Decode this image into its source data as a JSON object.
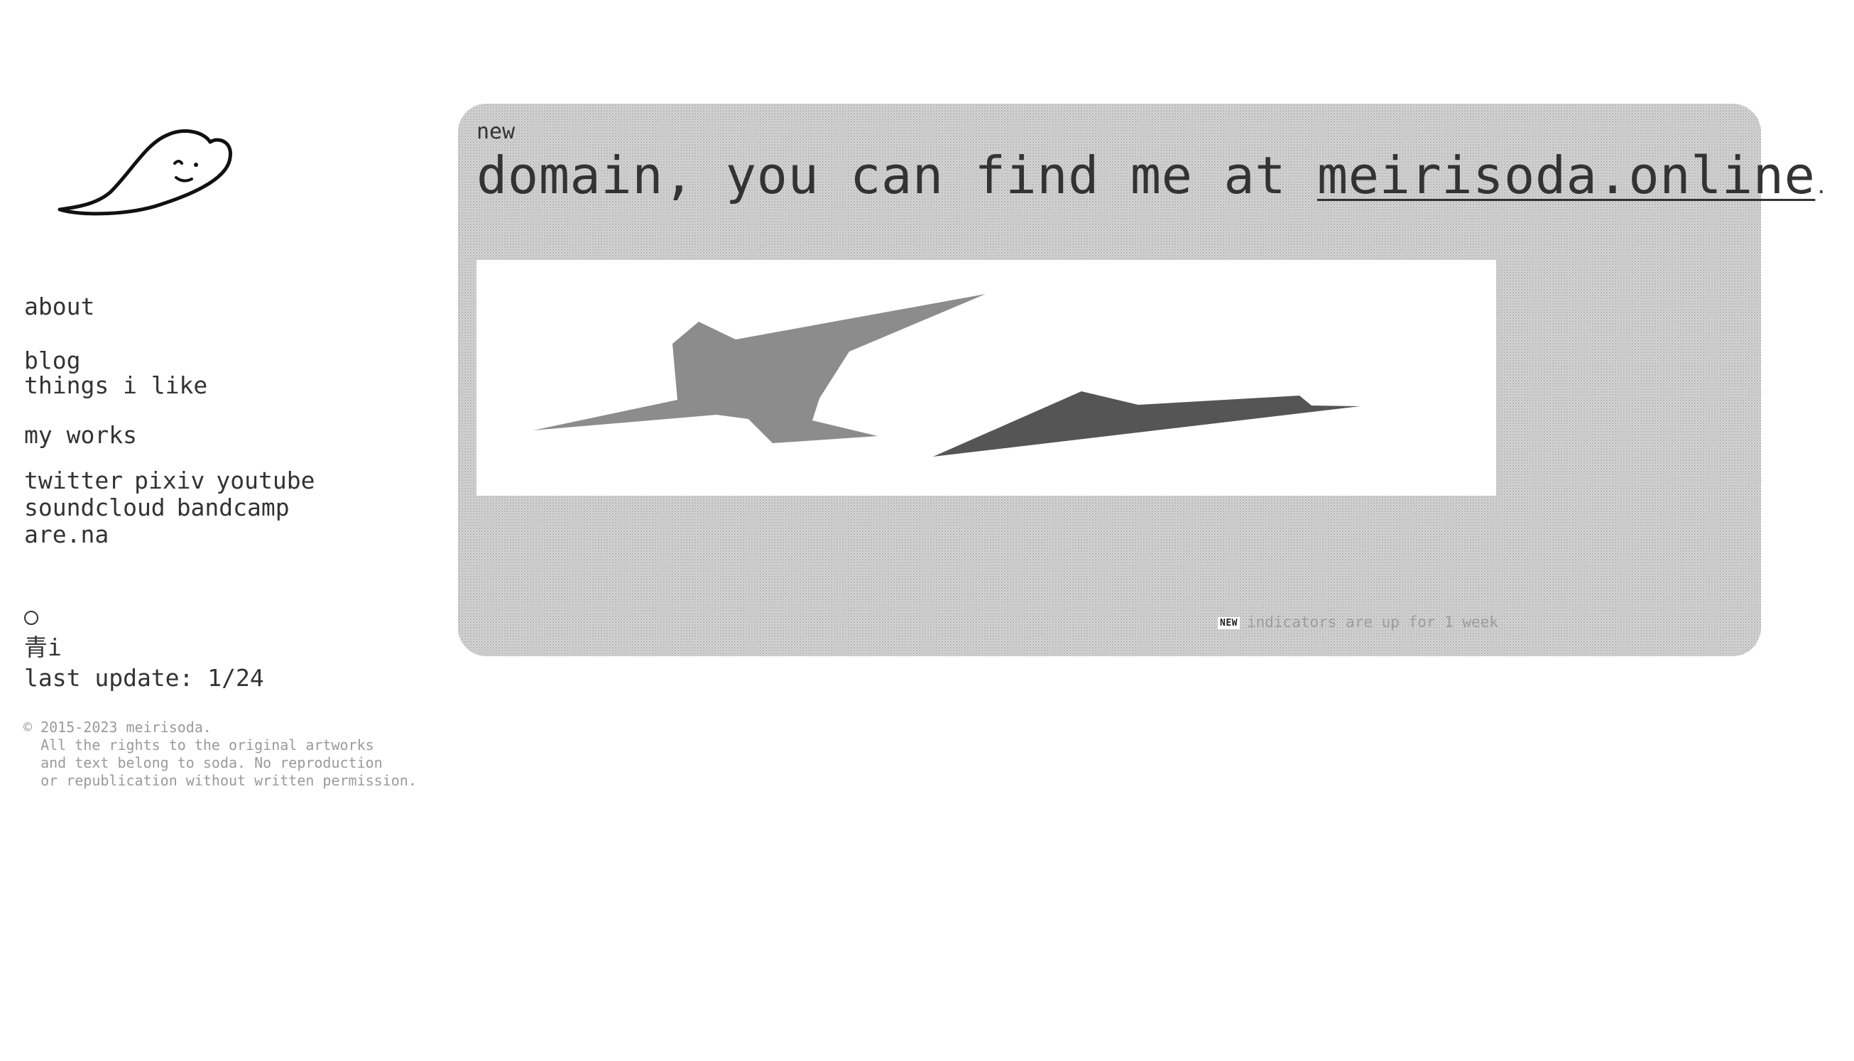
{
  "nav": {
    "about": "about",
    "blog": "blog",
    "things": "things i like",
    "works": "my works"
  },
  "social": [
    "twitter",
    "pixiv",
    "youtube",
    "soundcloud",
    "bandcamp",
    "are.na"
  ],
  "status": {
    "kanji": "青i",
    "last_update": "last update: 1/24"
  },
  "copyright": "© 2015-2023 meirisoda.\n  All the rights to the original artworks\n  and text belong to soda. No reproduction\n  or republication without written permission.",
  "card": {
    "new_label": "new",
    "headline_prefix": "domain, you can find me at ",
    "link_text": "meirisoda.online",
    "headline_suffix": ".",
    "badge": "NEW",
    "indicator_text": "indicators are up for 1 week"
  },
  "colors": {
    "text": "#333333",
    "card_bg": "#dcdcdc",
    "shape_light": "#8c8c8c",
    "shape_dark": "#555555"
  },
  "icons": {
    "logo": "ghost-blob-logo",
    "status": "circle-icon"
  }
}
